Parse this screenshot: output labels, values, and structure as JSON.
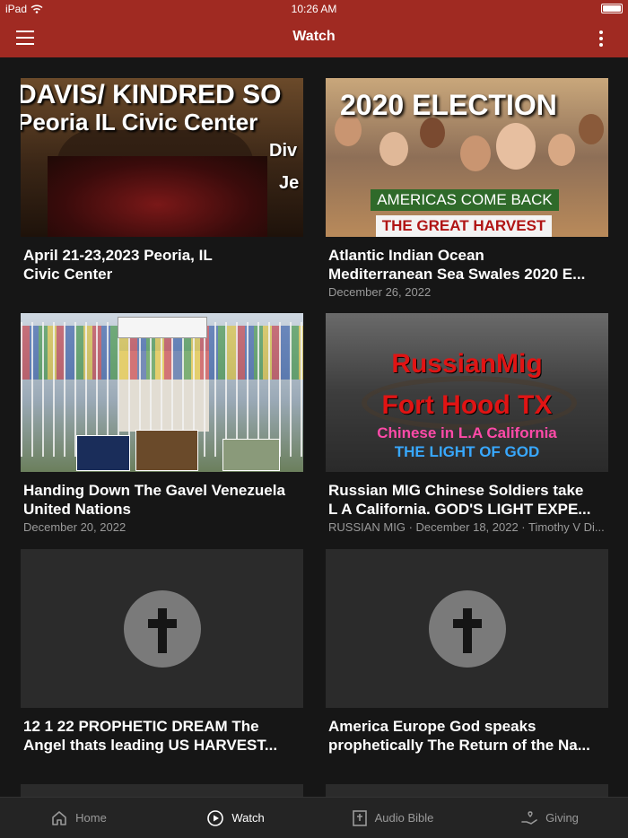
{
  "status_bar": {
    "device": "iPad",
    "time": "10:26 AM"
  },
  "app_bar": {
    "title": "Watch"
  },
  "videos": [
    {
      "title": "April 21-23,2023 Peoria,  IL\nCivic Center",
      "meta": "",
      "thumb_text": [
        "DAVIS/ KINDRED SO",
        "Peoria IL Civic Center",
        "Div",
        "Je"
      ]
    },
    {
      "title": "Atlantic Indian Ocean\nMediterranean Sea Swales 2020 E...",
      "meta": "December 26, 2022",
      "thumb_text": [
        "2020 ELECTION",
        "AMERICAS COME BACK",
        "THE GREAT HARVEST"
      ]
    },
    {
      "title": "Handing Down The Gavel Venezuela\nUnited Nations",
      "meta": "December 20, 2022",
      "thumb_text": []
    },
    {
      "title": "Russian MIG Chinese Soldiers take\nL A California. GOD'S LIGHT EXPE...",
      "meta": "RUSSIAN MIG · December 18, 2022 · Timothy V Di...",
      "thumb_text": [
        "RussianMig",
        "Fort Hood TX",
        "Chinese in L.A California",
        "THE LIGHT OF GOD"
      ]
    },
    {
      "title": "12 1 22 PROPHETIC DREAM The\nAngel thats leading US HARVEST...",
      "meta": "",
      "thumb_text": []
    },
    {
      "title": "America Europe God speaks\nprophetically The Return of the Na...",
      "meta": "",
      "thumb_text": []
    }
  ],
  "tabs": [
    {
      "label": "Home",
      "icon": "home-icon",
      "active": false
    },
    {
      "label": "Watch",
      "icon": "play-circle-icon",
      "active": true
    },
    {
      "label": "Audio Bible",
      "icon": "bible-icon",
      "active": false
    },
    {
      "label": "Giving",
      "icon": "giving-hand-icon",
      "active": false
    }
  ],
  "colors": {
    "accent": "#a02a22",
    "background": "#161616",
    "tabbar": "#242424",
    "meta_text": "#9a9a9a"
  }
}
